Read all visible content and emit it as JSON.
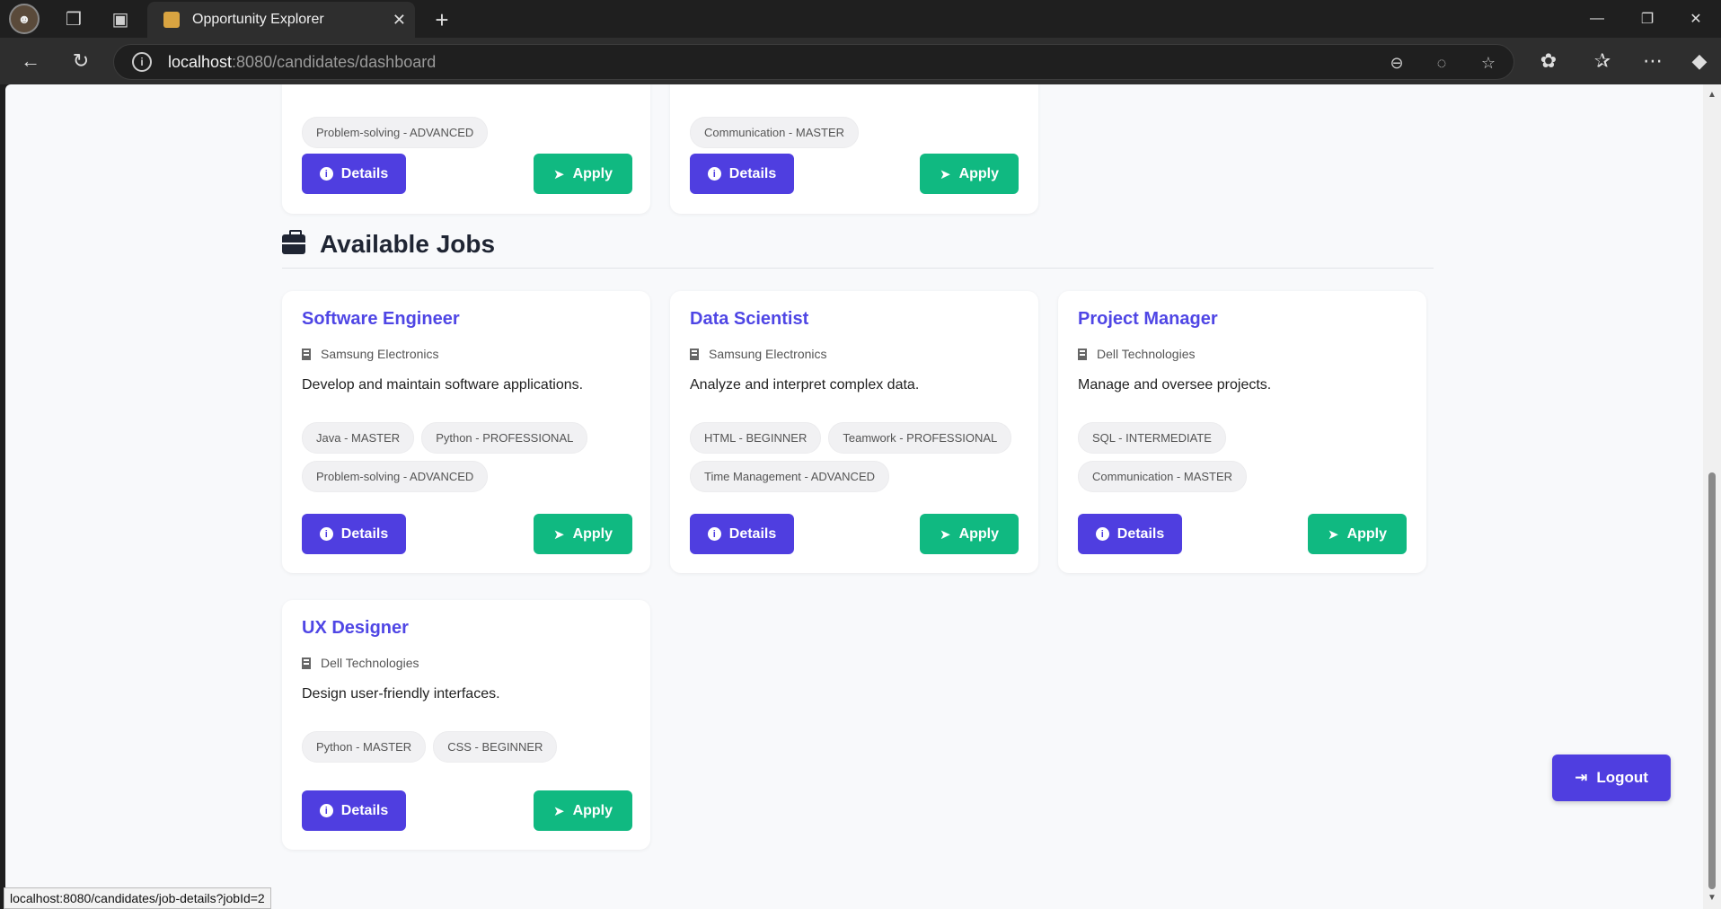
{
  "browser": {
    "tab_title": "Opportunity Explorer",
    "url_host": "localhost",
    "url_rest": ":8080/candidates/dashboard",
    "status_url": "localhost:8080/candidates/job-details?jobId=2"
  },
  "top_cards": [
    {
      "skills": [
        "Problem-solving - ADVANCED"
      ],
      "details_label": "Details",
      "apply_label": "Apply"
    },
    {
      "skills": [
        "Communication - MASTER"
      ],
      "details_label": "Details",
      "apply_label": "Apply"
    }
  ],
  "section": {
    "title": "Available Jobs"
  },
  "jobs": [
    {
      "title": "Software Engineer",
      "company": "Samsung Electronics",
      "description": "Develop and maintain software applications.",
      "skills": [
        "Java - MASTER",
        "Python - PROFESSIONAL",
        "Problem-solving - ADVANCED"
      ],
      "details_label": "Details",
      "apply_label": "Apply"
    },
    {
      "title": "Data Scientist",
      "company": "Samsung Electronics",
      "description": "Analyze and interpret complex data.",
      "skills": [
        "HTML - BEGINNER",
        "Teamwork - PROFESSIONAL",
        "Time Management - ADVANCED"
      ],
      "details_label": "Details",
      "apply_label": "Apply"
    },
    {
      "title": "Project Manager",
      "company": "Dell Technologies",
      "description": "Manage and oversee projects.",
      "skills": [
        "SQL - INTERMEDIATE",
        "Communication - MASTER"
      ],
      "details_label": "Details",
      "apply_label": "Apply"
    },
    {
      "title": "UX Designer",
      "company": "Dell Technologies",
      "description": "Design user-friendly interfaces.",
      "skills": [
        "Python - MASTER",
        "CSS - BEGINNER"
      ],
      "details_label": "Details",
      "apply_label": "Apply"
    }
  ],
  "logout_label": "Logout",
  "colors": {
    "primary": "#4f3ee0",
    "apply": "#10b981",
    "title": "#4f46e5"
  }
}
